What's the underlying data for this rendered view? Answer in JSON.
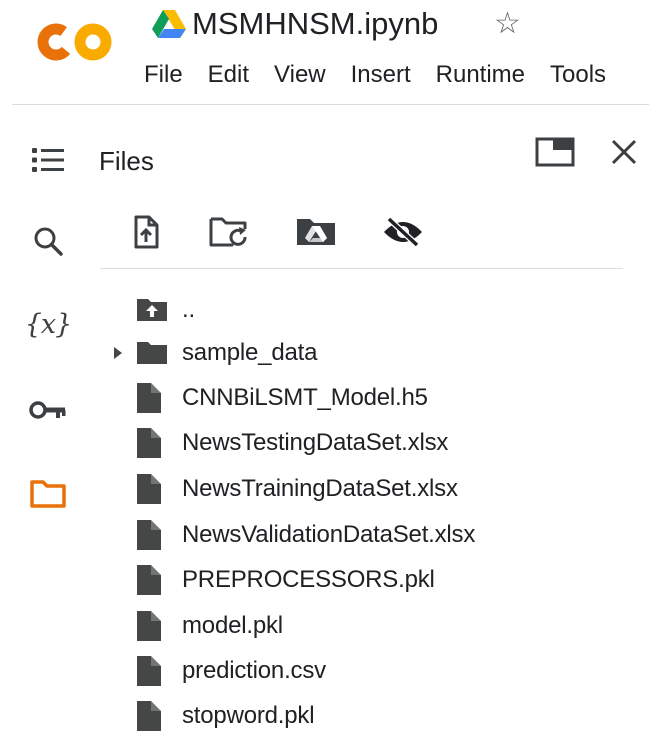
{
  "header": {
    "notebook_title": "MSMHNSM.ipynb",
    "star_glyph": "☆",
    "menu": [
      "File",
      "Edit",
      "View",
      "Insert",
      "Runtime",
      "Tools"
    ]
  },
  "rail": {
    "variables_label": "{x}"
  },
  "files_panel": {
    "title": "Files",
    "up_label": "..",
    "items": [
      {
        "name": "sample_data",
        "type": "folder"
      },
      {
        "name": "CNNBiLSMT_Model.h5",
        "type": "file"
      },
      {
        "name": "NewsTestingDataSet.xlsx",
        "type": "file"
      },
      {
        "name": "NewsTrainingDataSet.xlsx",
        "type": "file"
      },
      {
        "name": "NewsValidationDataSet.xlsx",
        "type": "file"
      },
      {
        "name": "PREPROCESSORS.pkl",
        "type": "file"
      },
      {
        "name": "model.pkl",
        "type": "file"
      },
      {
        "name": "prediction.csv",
        "type": "file"
      },
      {
        "name": "stopword.pkl",
        "type": "file"
      }
    ]
  },
  "colors": {
    "logo_orange": "#F9AB00",
    "logo_dark_orange": "#E8710A",
    "active_rail": "#E8710A",
    "icon_gray": "#5f6368",
    "file_icon": "#444746"
  }
}
